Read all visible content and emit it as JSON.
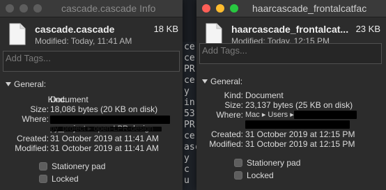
{
  "background_editor": {
    "lines": [
      "ce",
      "ce",
      "PR",
      "ce",
      "y",
      "in",
      "53",
      "PR",
      "ce",
      "asc",
      "y",
      "c",
      "u",
      "y"
    ]
  },
  "left_window": {
    "title": "cascade.cascade Info",
    "file_name": "cascade.cascade",
    "file_size": "18 KB",
    "modified_header": "Modified: Today, 11:41 AM",
    "tags_placeholder": "Add Tags...",
    "section_label": "General:",
    "kind_label": "Kind:",
    "kind_value": "Document",
    "size_label": "Size:",
    "size_value": "18,086 bytes (20 KB on disk)",
    "where_label": "Where:",
    "where_value": "py_project ▸ open-LPR-design",
    "created_label": "Created:",
    "created_value": "31 October 2019 at 11:41 AM",
    "modified_label": "Modified:",
    "modified_value": "31 October 2019 at 11:41 AM",
    "stationery_label": "Stationery pad",
    "locked_label": "Locked"
  },
  "right_window": {
    "title": "haarcascade_frontalcatfac",
    "file_name": "haarcascade_frontalcat...",
    "file_size": "23 KB",
    "modified_header": "Modified: Today, 12:15 PM",
    "tags_placeholder": "Add Tags...",
    "section_label": "General:",
    "kind_label": "Kind:",
    "kind_value": "Document",
    "size_label": "Size:",
    "size_value": "23,137 bytes (25 KB on disk)",
    "where_label": "Where:",
    "where_value": "Mac ▸ Users ▸",
    "created_label": "Created:",
    "created_value": "31 October 2019 at 12:15 PM",
    "modified_label": "Modified:",
    "modified_value": "31 October 2019 at 12:15 PM",
    "stationery_label": "Stationery pad",
    "locked_label": "Locked"
  },
  "colors": {
    "window_bg": "#2c2c2c",
    "titlebar_bg": "#3a3a3a",
    "close_red": "#ff5f57",
    "minimize_yellow": "#febc2e",
    "zoom_green": "#28c840",
    "redaction": "#000000"
  },
  "icons": [
    "document-icon",
    "disclosure-triangle-icon",
    "checkbox-icon",
    "traffic-light-close",
    "traffic-light-minimize",
    "traffic-light-zoom"
  ]
}
